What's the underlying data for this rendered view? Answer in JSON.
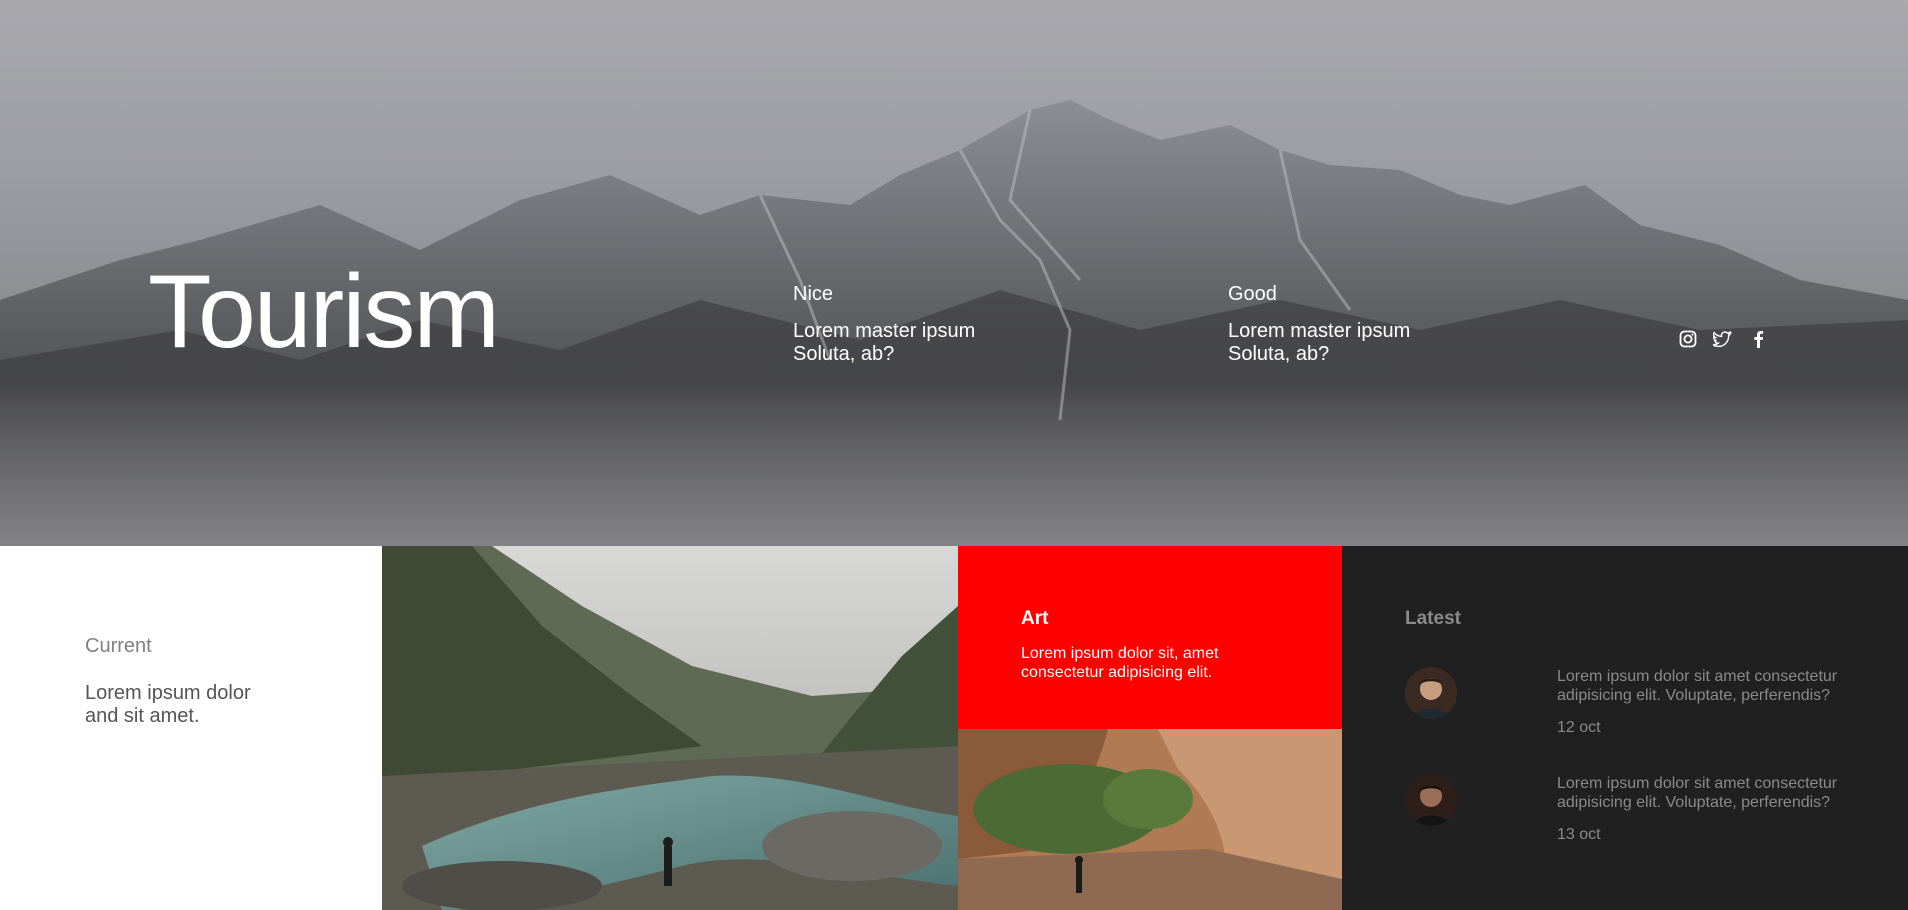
{
  "hero": {
    "title": "Tourism",
    "columns": [
      {
        "heading": "Nice",
        "text_line1": "Lorem master ipsum",
        "text_line2": "Soluta, ab?"
      },
      {
        "heading": "Good",
        "text_line1": "Lorem master ipsum",
        "text_line2": "Soluta, ab?"
      }
    ],
    "social_icons": [
      "instagram-icon",
      "twitter-icon",
      "facebook-icon"
    ]
  },
  "current": {
    "heading": "Current",
    "text_line1": "Lorem ipsum dolor",
    "text_line2": "and sit amet."
  },
  "art": {
    "heading": "Art",
    "text_line1": "Lorem ipsum dolor sit, amet",
    "text_line2": "consectetur adipisicing elit."
  },
  "latest": {
    "heading": "Latest",
    "posts": [
      {
        "line1": "Lorem ipsum dolor sit amet consectetur",
        "line2": "adipisicing elit. Voluptate, perferendis?",
        "date": "12 oct"
      },
      {
        "line1": "Lorem ipsum dolor sit amet consectetur",
        "line2": "adipisicing elit. Voluptate, perferendis?",
        "date": "13 oct"
      }
    ]
  },
  "colors": {
    "accent": "#ff0000",
    "dark_panel": "#202020",
    "muted_text": "#8a8a8a"
  }
}
